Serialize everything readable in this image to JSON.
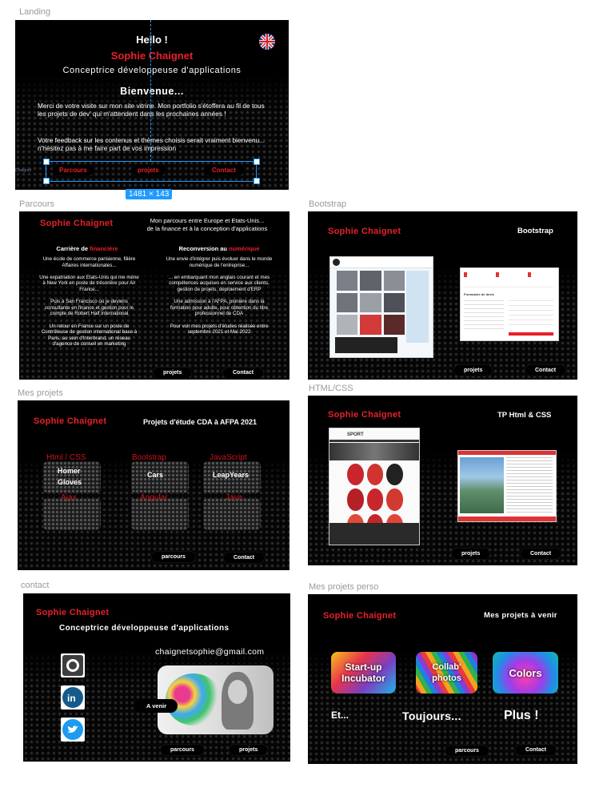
{
  "labels": {
    "landing": "Landing",
    "parcours": "Parcours",
    "bootstrap": "Bootstrap",
    "mes_projets": "Mes projets",
    "html_css": "HTML/CSS",
    "contact": "contact",
    "perso": "Mes projets perso"
  },
  "landing": {
    "hello": "Hello !",
    "name": "Sophie Chaignet",
    "role": "Conceptrice développeuse d'applications",
    "welcome": "Bienvenue...",
    "para1": "Merci de votre visite sur mon site vitrine. Mon portfolio s'étoffera au fil de tous les projets de dev' qui m'attendent dans les prochaines années !",
    "para2": "Votre feedback sur les contenus et thèmes choisis serait vraiment bienvenu... n'hésitez  pas à me faire part de vos impression",
    "nav": [
      "Parcours",
      "projets",
      "Contact"
    ],
    "selection_size": "1481 × 143",
    "side_label": "Chaignet"
  },
  "parcours": {
    "brand": "Sophie Chaignet",
    "title": "Mon parcours entre Europe et Etats-Unis...\nde la finance et à la conception d'applications",
    "left_title_a": "Carrière de ",
    "left_title_b": "financière",
    "left_text": "Une école de commerce parisienne, filière Affaires internationales...\n\nUne expatriation aux Etats-Unis qui me mène à New York en poste de trésorière pour Air France...\n\nPuis à San Francisco où je deviens consultante en finance et gestion pour le compte de Robert Half International\n\nUn retour en France sur un poste de Contrôleuse de gestion international base à Paris, au sein d'Interbrand, un réseau d'agence de conseil en marketing",
    "right_title_a": "Reconversion au ",
    "right_title_b": "numérique",
    "right_text": "Une envie d'intégrer puis évoluer dans le monde numérique de l'entreprise...\n\n... en embarquant mon anglais courant et mes compétences acquises en service aux clients, gestion de projets, deploiement d'ERP\n\nUne admission à l'AFPA, pionière dans la formation pour adulte, pour obtention du titre professionnel de CDA\n\nPour voir mes projets d'études réalisée entre septembre 2021 et Mai 2022",
    "nav": [
      "projets",
      "Contact"
    ]
  },
  "bootstrap": {
    "brand": "Sophie Chaignet",
    "title": "Bootstrap",
    "nav": [
      "projets",
      "Contact"
    ],
    "form_title": "Formulaire de devis"
  },
  "mesprojets": {
    "brand": "Sophie Chaignet",
    "title": "Projets d'étude CDA à AFPA 2021",
    "cats": [
      {
        "cat": "Html / CSS",
        "sub": "Homer\nGloves"
      },
      {
        "cat": "Bootstrap",
        "sub": "Cars"
      },
      {
        "cat": "JavaScript",
        "sub": "LeapYears"
      },
      {
        "cat": "Ajax",
        "sub": ""
      },
      {
        "cat": "Angular",
        "sub": ""
      },
      {
        "cat": "Java",
        "sub": ""
      }
    ],
    "nav": [
      "parcours",
      "Contact"
    ]
  },
  "htmlcss": {
    "brand": "Sophie Chaignet",
    "title": "TP Html & CSS",
    "nav": [
      "projets",
      "Contact"
    ],
    "site_logo": "SPORT"
  },
  "contact": {
    "brand": "Sophie Chaignet",
    "role": "Conceptrice développeuse d'applications",
    "email": "chaignetsophie@gmail.com",
    "avenir": "A venir",
    "nav": [
      "parcours",
      "projets"
    ]
  },
  "perso": {
    "brand": "Sophie Chaignet",
    "title": "Mes projets à venir",
    "tiles": [
      "Start-up\nIncubator",
      "Collab'\nphotos",
      "Colors"
    ],
    "et": "Et...",
    "toujours": "Toujours...",
    "plus": "Plus !",
    "nav": [
      "parcours",
      "Contact"
    ]
  },
  "colors": {
    "accent": "#e8202a",
    "selection": "#1e9bff"
  }
}
